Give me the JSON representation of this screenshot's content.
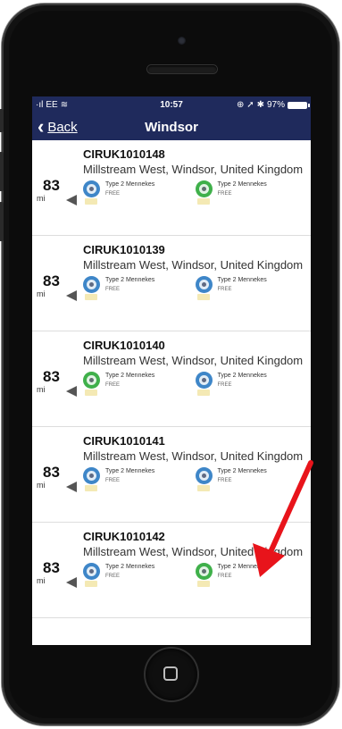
{
  "status_bar": {
    "carrier": "EE",
    "time": "10:57",
    "battery": "97%"
  },
  "nav": {
    "back_label": "Back",
    "title": "Windsor"
  },
  "locations": [
    {
      "id": "CIRUK1010148",
      "address": "Millstream West, Windsor, United Kingdom",
      "distance": "83",
      "unit": "mi",
      "connectors": [
        {
          "type": "Type 2 Mennekes",
          "price": "FREE",
          "color": "blue"
        },
        {
          "type": "Type 2 Mennekes",
          "price": "FREE",
          "color": "green"
        }
      ]
    },
    {
      "id": "CIRUK1010139",
      "address": "Millstream West, Windsor, United Kingdom",
      "distance": "83",
      "unit": "mi",
      "connectors": [
        {
          "type": "Type 2 Mennekes",
          "price": "FREE",
          "color": "blue"
        },
        {
          "type": "Type 2 Mennekes",
          "price": "FREE",
          "color": "blue"
        }
      ]
    },
    {
      "id": "CIRUK1010140",
      "address": "Millstream West, Windsor, United Kingdom",
      "distance": "83",
      "unit": "mi",
      "connectors": [
        {
          "type": "Type 2 Mennekes",
          "price": "FREE",
          "color": "green"
        },
        {
          "type": "Type 2 Mennekes",
          "price": "FREE",
          "color": "blue"
        }
      ]
    },
    {
      "id": "CIRUK1010141",
      "address": "Millstream West, Windsor, United Kingdom",
      "distance": "83",
      "unit": "mi",
      "connectors": [
        {
          "type": "Type 2 Mennekes",
          "price": "FREE",
          "color": "blue"
        },
        {
          "type": "Type 2 Mennekes",
          "price": "FREE",
          "color": "blue"
        }
      ]
    },
    {
      "id": "CIRUK1010142",
      "address": "Millstream West, Windsor, United Kingdom",
      "distance": "83",
      "unit": "mi",
      "connectors": [
        {
          "type": "Type 2 Mennekes",
          "price": "FREE",
          "color": "blue"
        },
        {
          "type": "Type 2 Mennekes",
          "price": "FREE",
          "color": "green"
        }
      ]
    }
  ],
  "annotation": {
    "color": "#e8141b"
  },
  "theme": {
    "nav_bg": "#1f2a5c",
    "blue_connector": "#3e86c8",
    "green_connector": "#3fb04a"
  }
}
